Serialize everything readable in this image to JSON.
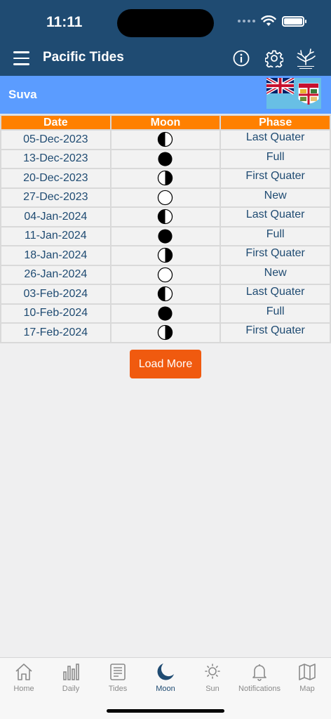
{
  "status": {
    "time": "11:11"
  },
  "appbar": {
    "title": "Pacific Tides"
  },
  "location": {
    "name": "Suva"
  },
  "table": {
    "headers": {
      "date": "Date",
      "moon": "Moon",
      "phase": "Phase"
    },
    "rows": [
      {
        "date": "05-Dec-2023",
        "moon": "last-quarter-icon",
        "phase": "Last Quater"
      },
      {
        "date": "13-Dec-2023",
        "moon": "full-moon-icon",
        "phase": "Full"
      },
      {
        "date": "20-Dec-2023",
        "moon": "first-quarter-icon",
        "phase": "First Quater"
      },
      {
        "date": "27-Dec-2023",
        "moon": "new-moon-icon",
        "phase": "New"
      },
      {
        "date": "04-Jan-2024",
        "moon": "last-quarter-icon",
        "phase": "Last Quater"
      },
      {
        "date": "11-Jan-2024",
        "moon": "full-moon-icon",
        "phase": "Full"
      },
      {
        "date": "18-Jan-2024",
        "moon": "first-quarter-icon",
        "phase": "First Quater"
      },
      {
        "date": "26-Jan-2024",
        "moon": "new-moon-icon",
        "phase": "New"
      },
      {
        "date": "03-Feb-2024",
        "moon": "last-quarter-icon",
        "phase": "Last Quater"
      },
      {
        "date": "10-Feb-2024",
        "moon": "full-moon-icon",
        "phase": "Full"
      },
      {
        "date": "17-Feb-2024",
        "moon": "first-quarter-icon",
        "phase": "First Quater"
      }
    ]
  },
  "load_more_label": "Load More",
  "tabs": [
    {
      "label": "Home",
      "icon": "home-icon"
    },
    {
      "label": "Daily",
      "icon": "bar-chart-icon"
    },
    {
      "label": "Tides",
      "icon": "document-icon"
    },
    {
      "label": "Moon",
      "icon": "moon-icon",
      "active": true
    },
    {
      "label": "Sun",
      "icon": "sun-icon"
    },
    {
      "label": "Notifications",
      "icon": "bell-icon"
    },
    {
      "label": "Map",
      "icon": "map-icon"
    }
  ],
  "colors": {
    "header_bg": "#1f4b72",
    "location_bg": "#5b9cff",
    "table_header_bg": "#ff8000",
    "button_bg": "#f05a0f",
    "text_blue": "#1f4b72"
  }
}
